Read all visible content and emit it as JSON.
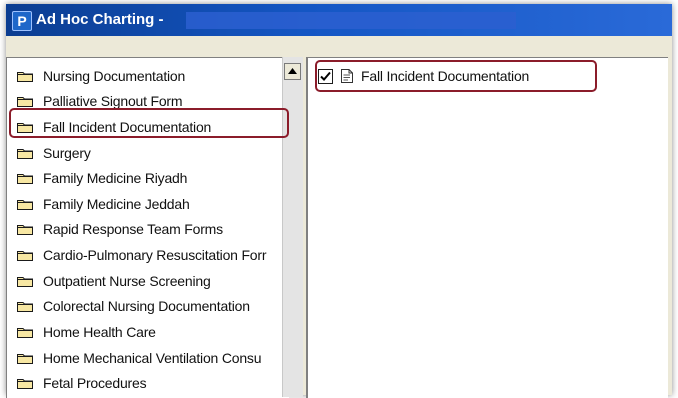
{
  "window": {
    "app_icon_letter": "P",
    "title": "Ad Hoc Charting -"
  },
  "left_tree": {
    "items": [
      {
        "label": "Nursing Documentation"
      },
      {
        "label": "Palliative Signout Form"
      },
      {
        "label": "Fall Incident Documentation"
      },
      {
        "label": "Surgery"
      },
      {
        "label": "Family Medicine Riyadh"
      },
      {
        "label": "Family Medicine Jeddah"
      },
      {
        "label": "Rapid Response Team Forms"
      },
      {
        "label": "Cardio-Pulmonary Resuscitation Forr"
      },
      {
        "label": "Outpatient Nurse Screening"
      },
      {
        "label": "Colorectal Nursing Documentation"
      },
      {
        "label": "Home Health Care"
      },
      {
        "label": "Home Mechanical Ventilation Consu"
      },
      {
        "label": "Fetal Procedures"
      }
    ],
    "highlighted_index": 2
  },
  "right_list": {
    "items": [
      {
        "label": "Fall Incident Documentation",
        "checked": true
      }
    ]
  },
  "colors": {
    "title_bar": "#0b3d91",
    "highlight_border": "#8b1c2a",
    "folder_fill": "#f7e7a3"
  }
}
